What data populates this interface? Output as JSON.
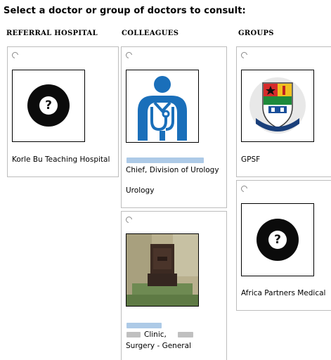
{
  "header": {
    "title": "Select a doctor or group of doctors to consult:"
  },
  "columns": {
    "referral_hospital": "REFERRAL HOSPITAL",
    "colleagues": "COLLEAGUES",
    "groups": "GROUPS"
  },
  "referral": [
    {
      "name": "Korle Bu Teaching Hospital",
      "icon": "question-mark-icon"
    }
  ],
  "colleagues": [
    {
      "title": "Chief, Division of Urology",
      "specialty": "Urology",
      "icon": "doctor-stethoscope-icon"
    },
    {
      "title": "Clinic,",
      "specialty": "Surgery - General",
      "icon": "photo-avatar"
    }
  ],
  "groups": [
    {
      "name": "GPSF",
      "icon": "crest-logo"
    },
    {
      "name": "Africa Partners Medical",
      "icon": "question-mark-icon"
    }
  ],
  "colors": {
    "doctor_blue": "#1a6fba",
    "card_border": "#bdbdbd",
    "redaction_blue": "#9fc1e3"
  }
}
